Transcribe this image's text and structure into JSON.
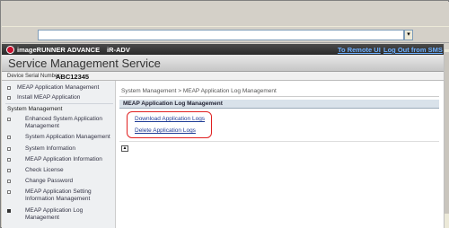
{
  "browser": {
    "address_value": "",
    "dropdown_glyph": "▾"
  },
  "header": {
    "brand": "imageRUNNER ADVANCE",
    "model": "iR-ADV",
    "link_remote_ui": "To Remote UI",
    "link_logout": "Log Out from SMS",
    "title": "Service Management Service",
    "serial_label": "Device Serial Number:",
    "serial_value": "ABC12345"
  },
  "sidebar": {
    "top_items": [
      {
        "label": "MEAP Application Management"
      },
      {
        "label": "Install MEAP Application"
      }
    ],
    "section_label": "System Management",
    "items": [
      {
        "label": "Enhanced System Application Management"
      },
      {
        "label": "System Application Management"
      },
      {
        "label": "System Information"
      },
      {
        "label": "MEAP Application Information"
      },
      {
        "label": "Check License"
      },
      {
        "label": "Change Password"
      },
      {
        "label": "MEAP Application Setting Information Management"
      },
      {
        "label": "MEAP Application Log Management"
      }
    ]
  },
  "main": {
    "breadcrumb": "System Management > MEAP Application Log Management",
    "panel_title": "MEAP Application Log Management",
    "links": [
      {
        "label": "Download Application Logs"
      },
      {
        "label": "Delete Application Logs"
      }
    ],
    "top_button_glyph": "▲"
  },
  "colors": {
    "highlight": "#e02020",
    "link": "#1e3c96",
    "topbar_link": "#6fb1ff"
  }
}
